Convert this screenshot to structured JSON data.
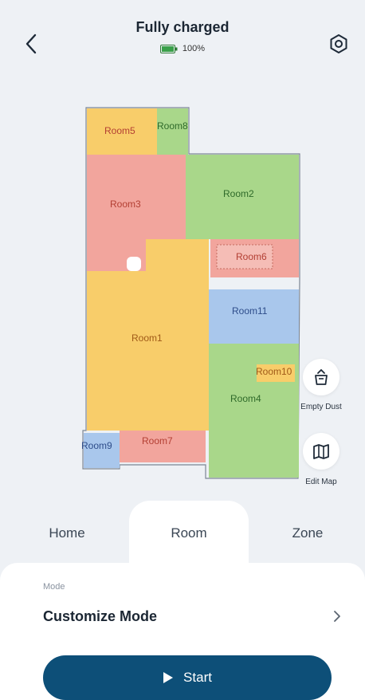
{
  "header": {
    "title": "Fully charged",
    "battery_percent_label": "100%",
    "battery_level": 100
  },
  "map": {
    "rooms": [
      {
        "label": "Room5"
      },
      {
        "label": "Room8"
      },
      {
        "label": "Room3"
      },
      {
        "label": "Room2"
      },
      {
        "label": "Room6"
      },
      {
        "label": "Room11"
      },
      {
        "label": "Room1"
      },
      {
        "label": "Room10"
      },
      {
        "label": "Room4"
      },
      {
        "label": "Room9"
      },
      {
        "label": "Room7"
      }
    ],
    "empty_dust_label": "Empty Dust",
    "edit_map_label": "Edit Map"
  },
  "tabs": [
    {
      "label": "Home",
      "active": false
    },
    {
      "label": "Room",
      "active": true
    },
    {
      "label": "Zone",
      "active": false
    }
  ],
  "mode": {
    "caption": "Mode",
    "value": "Customize Mode"
  },
  "start_button_label": "Start",
  "colors": {
    "room_yellow": "#f8cd6a",
    "room_red": "#f2a59d",
    "room_green": "#a9d78a",
    "room_blue": "#a9c7ec",
    "primary": "#0d4f78"
  },
  "icons": {
    "back": "chevron-left-icon",
    "settings": "settings-icon",
    "battery": "battery-icon",
    "empty_dust": "dustbin-icon",
    "edit_map": "map-icon",
    "start": "play-icon",
    "mode_chevron": "chevron-right-icon"
  }
}
